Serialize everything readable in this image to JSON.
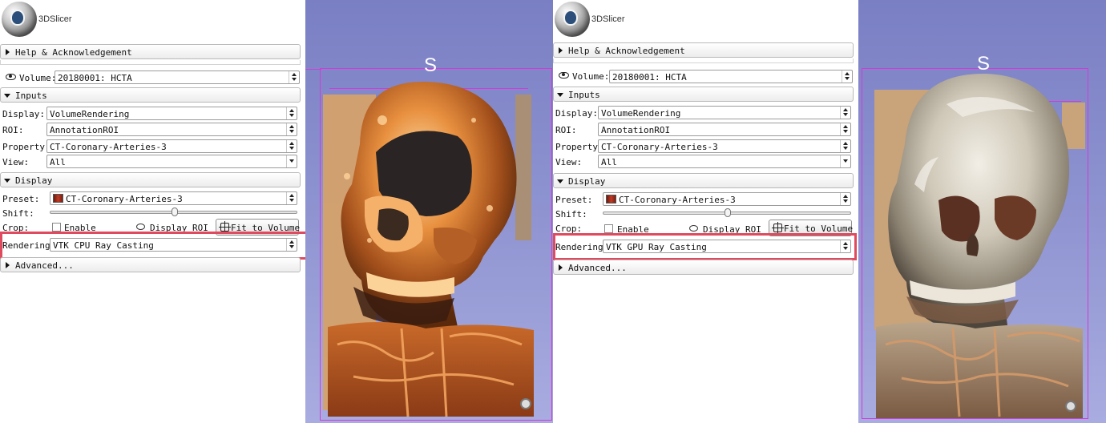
{
  "app": {
    "logo_text": "3DSlicer"
  },
  "panels": [
    {
      "sections": {
        "help": "Help & Acknowledgement",
        "inputs": "Inputs",
        "display": "Display",
        "advanced": "Advanced..."
      },
      "volume": {
        "label": "Volume:",
        "value": "20180001: HCTA"
      },
      "inputs": {
        "display_label": "Display:",
        "display_value": "VolumeRendering",
        "roi_label": "ROI:",
        "roi_value": "AnnotationROI",
        "property_label": "Property:",
        "property_value": "CT-Coronary-Arteries-3",
        "view_label": "View:",
        "view_value": "All"
      },
      "display": {
        "preset_label": "Preset:",
        "preset_value": "CT-Coronary-Arteries-3",
        "shift_label": "Shift:",
        "shift_position": 0.5,
        "crop_label": "Crop:",
        "enable_label": "Enable",
        "display_roi_label": "Display ROI",
        "fit_label": "Fit to Volume",
        "rendering_label": "Rendering:",
        "rendering_value": "VTK CPU Ray Casting"
      },
      "view": {
        "orientation": "S"
      }
    },
    {
      "sections": {
        "help": "Help & Acknowledgement",
        "inputs": "Inputs",
        "display": "Display",
        "advanced": "Advanced..."
      },
      "volume": {
        "label": "Volume:",
        "value": "20180001: HCTA"
      },
      "inputs": {
        "display_label": "Display:",
        "display_value": "VolumeRendering",
        "roi_label": "ROI:",
        "roi_value": "AnnotationROI",
        "property_label": "Property:",
        "property_value": "CT-Coronary-Arteries-3",
        "view_label": "View:",
        "view_value": "All"
      },
      "display": {
        "preset_label": "Preset:",
        "preset_value": "CT-Coronary-Arteries-3",
        "shift_label": "Shift:",
        "shift_position": 0.5,
        "crop_label": "Crop:",
        "enable_label": "Enable",
        "display_roi_label": "Display ROI",
        "fit_label": "Fit to Volume",
        "rendering_label": "Rendering:",
        "rendering_value": "VTK GPU Ray Casting"
      },
      "view": {
        "orientation": "S"
      }
    }
  ],
  "colors": {
    "highlight": "#e04a5e",
    "roi_box": "#d23cd6",
    "view_bg": "#7a7fc4"
  }
}
